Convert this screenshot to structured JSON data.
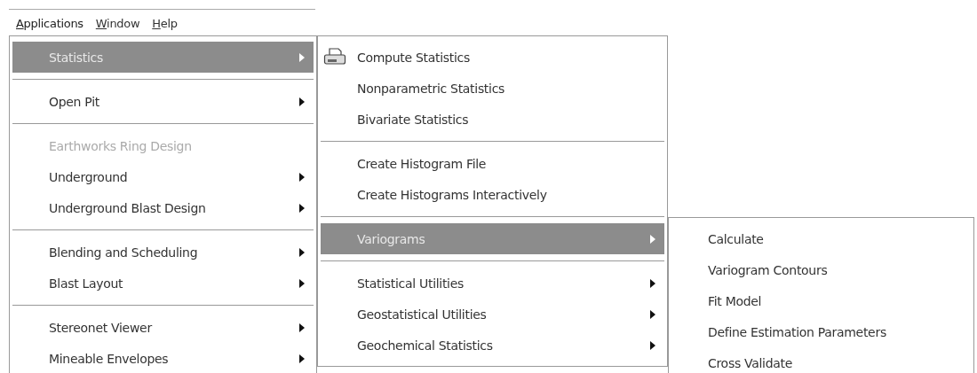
{
  "menubar": [
    {
      "key": "A",
      "after": "pplications",
      "selected": true
    },
    {
      "key": "W",
      "after": "indow",
      "selected": false
    },
    {
      "key": "H",
      "after": "elp",
      "selected": false
    }
  ],
  "menu": {
    "items": [
      {
        "kind": "item",
        "label": "Statistics",
        "selected": true,
        "disabled": false,
        "has_submenu": true,
        "children": [
          {
            "kind": "icon_item",
            "label": "Compute Statistics",
            "selected": false,
            "disabled": false,
            "has_submenu": false
          },
          {
            "kind": "item",
            "label": "Nonparametric Statistics",
            "selected": false,
            "disabled": false,
            "has_submenu": false
          },
          {
            "kind": "item",
            "label": "Bivariate Statistics",
            "selected": false,
            "disabled": false,
            "has_submenu": false
          },
          {
            "kind": "separator"
          },
          {
            "kind": "item",
            "label": "Create Histogram File",
            "selected": false,
            "disabled": false,
            "has_submenu": false
          },
          {
            "kind": "item",
            "label": "Create Histograms Interactively",
            "selected": false,
            "disabled": false,
            "has_submenu": false
          },
          {
            "kind": "separator"
          },
          {
            "kind": "item",
            "label": "Variograms",
            "selected": true,
            "disabled": false,
            "has_submenu": true,
            "children": [
              {
                "kind": "item",
                "label": "Calculate",
                "selected": false,
                "disabled": false,
                "has_submenu": false
              },
              {
                "kind": "item",
                "label": "Variogram Contours",
                "selected": false,
                "disabled": false,
                "has_submenu": false
              },
              {
                "kind": "item",
                "label": "Fit Model",
                "selected": false,
                "disabled": false,
                "has_submenu": false
              },
              {
                "kind": "item",
                "label": "Define Estimation Parameters",
                "selected": false,
                "disabled": false,
                "has_submenu": false
              },
              {
                "kind": "item",
                "label": "Cross Validate",
                "selected": false,
                "disabled": false,
                "has_submenu": false
              }
            ]
          },
          {
            "kind": "separator"
          },
          {
            "kind": "item",
            "label": "Statistical Utilities",
            "selected": false,
            "disabled": false,
            "has_submenu": true
          },
          {
            "kind": "item",
            "label": "Geostatistical Utilities",
            "selected": false,
            "disabled": false,
            "has_submenu": true
          },
          {
            "kind": "item",
            "label": "Geochemical Statistics",
            "selected": false,
            "disabled": false,
            "has_submenu": true
          }
        ]
      },
      {
        "kind": "separator"
      },
      {
        "kind": "item",
        "label": "Open Pit",
        "selected": false,
        "disabled": false,
        "has_submenu": true
      },
      {
        "kind": "separator"
      },
      {
        "kind": "item",
        "label": "Earthworks Ring Design",
        "selected": false,
        "disabled": true,
        "has_submenu": false
      },
      {
        "kind": "item",
        "label": "Underground",
        "selected": false,
        "disabled": false,
        "has_submenu": true
      },
      {
        "kind": "item",
        "label": "Underground Blast Design",
        "selected": false,
        "disabled": false,
        "has_submenu": true
      },
      {
        "kind": "separator"
      },
      {
        "kind": "item",
        "label": "Blending and Scheduling",
        "selected": false,
        "disabled": false,
        "has_submenu": true
      },
      {
        "kind": "item",
        "label": "Blast Layout",
        "selected": false,
        "disabled": false,
        "has_submenu": true
      },
      {
        "kind": "separator"
      },
      {
        "kind": "item",
        "label": "Stereonet Viewer",
        "selected": false,
        "disabled": false,
        "has_submenu": true
      },
      {
        "kind": "item",
        "label": "Mineable Envelopes",
        "selected": false,
        "disabled": false,
        "has_submenu": true
      }
    ]
  }
}
